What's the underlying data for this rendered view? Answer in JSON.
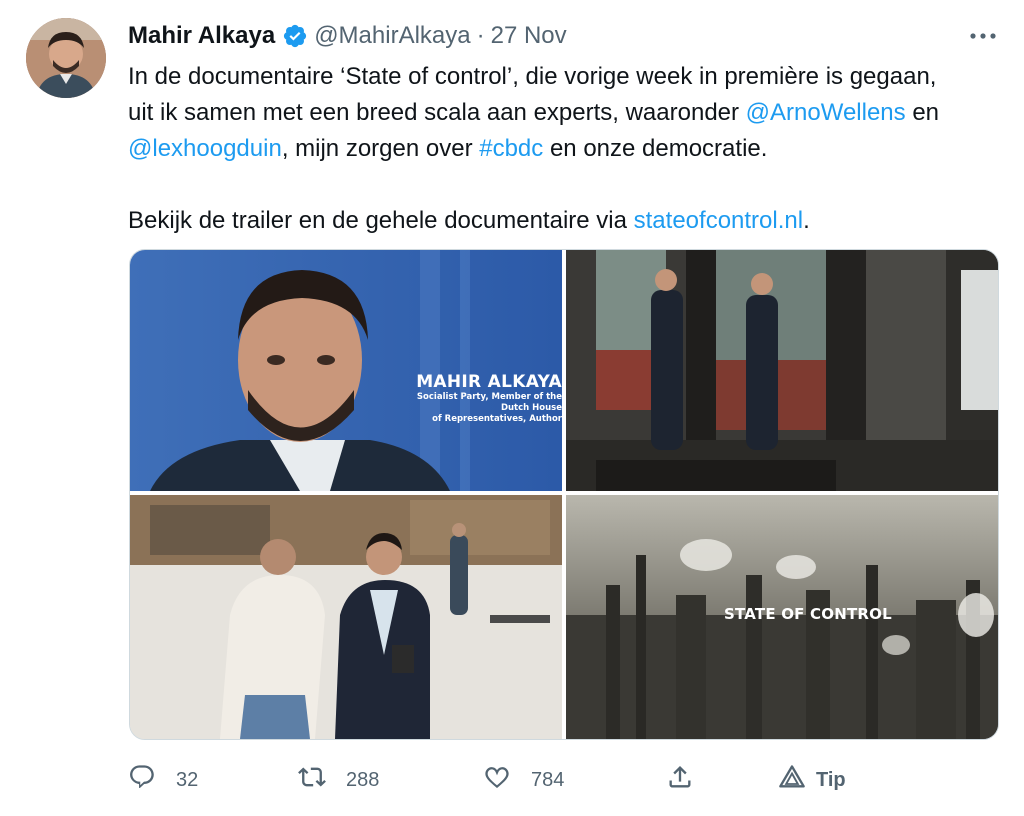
{
  "tweet": {
    "author_name": "Mahir Alkaya",
    "handle": "@MahirAlkaya",
    "separator": "·",
    "date": "27 Nov",
    "text_lines": [
      [
        {
          "t": "In de documentaire ‘State of control’, die vorige week in première is gegaan,"
        }
      ],
      [
        {
          "t": "uit ik samen met een breed scala aan experts, waaronder "
        },
        {
          "t": "@ArnoWellens",
          "link": true
        },
        {
          "t": " en"
        }
      ],
      [
        {
          "t": "@lexhoogduin",
          "link": true
        },
        {
          "t": ", mijn zorgen over "
        },
        {
          "t": "#cbdc",
          "link": true
        },
        {
          "t": " en onze democratie."
        }
      ],
      [
        {
          "t": ""
        }
      ],
      [
        {
          "t": "Bekijk de trailer en de gehele documentaire via "
        },
        {
          "t": "stateofcontrol.nl",
          "link": true
        },
        {
          "t": "."
        }
      ]
    ]
  },
  "media": {
    "lower_third_name": "MAHIR ALKAYA",
    "lower_third_role_1": "Socialist Party, Member of the Dutch House",
    "lower_third_role_2": "of Representatives, Author",
    "film_title": "STATE OF CONTROL"
  },
  "actions": {
    "replies": "32",
    "retweets": "288",
    "likes": "784",
    "tip_label": "Tip"
  },
  "icons": [
    "verified-badge-icon",
    "more-icon",
    "reply-icon",
    "retweet-icon",
    "like-icon",
    "share-icon",
    "tip-icon"
  ],
  "colors": {
    "link": "#1d9bf0",
    "secondary": "#536471",
    "verified": "#1d9bf0"
  }
}
